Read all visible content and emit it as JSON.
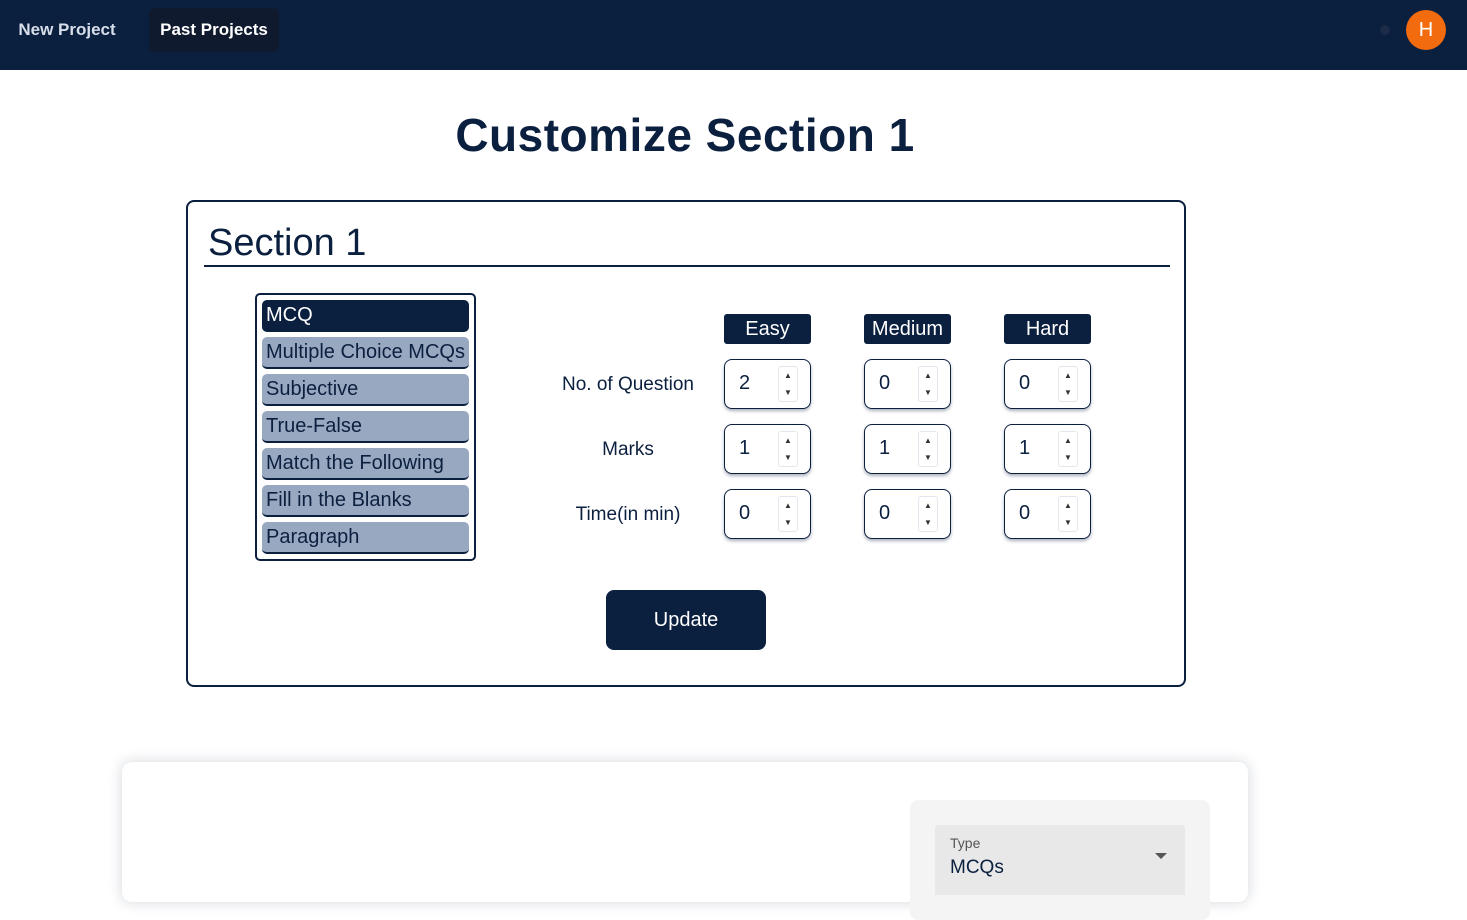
{
  "nav": {
    "new_project": "New Project",
    "past_projects": "Past Projects",
    "avatar_initial": "H"
  },
  "page": {
    "title": "Customize Section 1"
  },
  "section": {
    "title": "Section 1",
    "question_types": [
      {
        "label": "MCQ",
        "active": true
      },
      {
        "label": "Multiple Choice MCQs",
        "active": false
      },
      {
        "label": "Subjective",
        "active": false
      },
      {
        "label": "True-False",
        "active": false
      },
      {
        "label": "Match the Following",
        "active": false
      },
      {
        "label": "Fill in the Blanks",
        "active": false
      },
      {
        "label": "Paragraph",
        "active": false
      }
    ],
    "difficulties": [
      "Easy",
      "Medium",
      "Hard"
    ],
    "rows": [
      {
        "label": "No. of Question",
        "values": [
          "2",
          "0",
          "0"
        ]
      },
      {
        "label": "Marks",
        "values": [
          "1",
          "1",
          "1"
        ]
      },
      {
        "label": "Time(in min)",
        "values": [
          "0",
          "0",
          "0"
        ]
      }
    ],
    "update_label": "Update"
  },
  "filter": {
    "type_label": "Type",
    "type_value": "MCQs"
  },
  "colors": {
    "navy": "#0b1f3f",
    "inactive_item": "#98a8c1",
    "avatar": "#f26b0f"
  }
}
